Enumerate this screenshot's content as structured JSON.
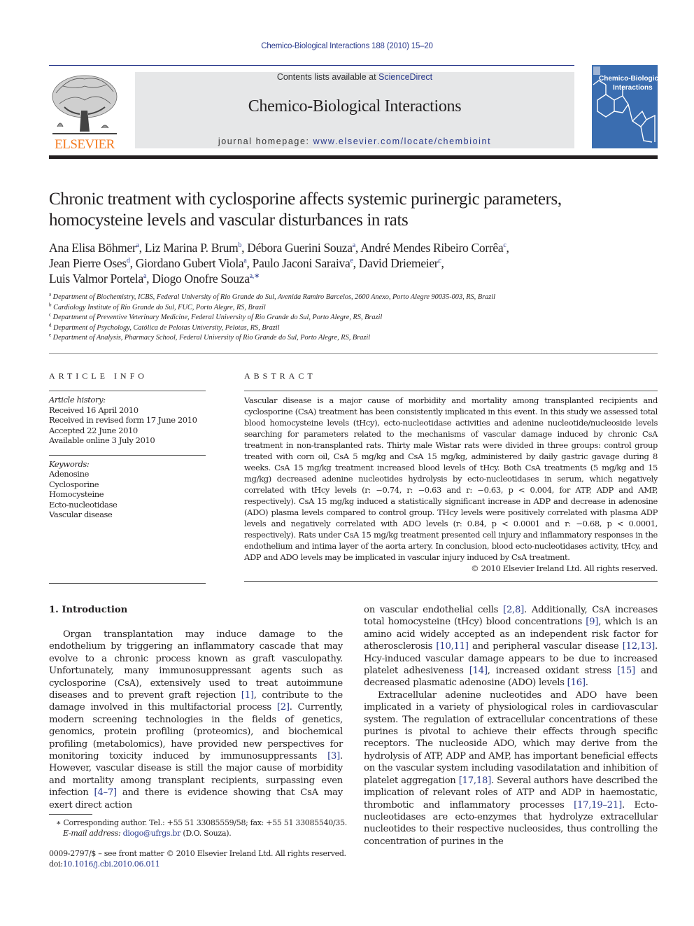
{
  "header": {
    "running_head": "Chemico-Biological Interactions 188 (2010) 15–20",
    "publisher": "ELSEVIER",
    "contents_prefix": "Contents lists available at ",
    "contents_link": "ScienceDirect",
    "journal_name": "Chemico-Biological Interactions",
    "homepage_prefix": "journal homepage: ",
    "homepage_link": "www.elsevier.com/locate/chembioint",
    "cover": {
      "title_line1": "Chemico-Biological",
      "title_line2": "Interactions",
      "color": "#3a6db0"
    }
  },
  "article": {
    "title_line1": "Chronic treatment with cyclosporine affects systemic purinergic parameters,",
    "title_line2": "homocysteine levels and vascular disturbances in rats",
    "authors": [
      {
        "name": "Ana Elisa Böhmer",
        "aff": "a"
      },
      {
        "name": "Liz Marina P. Brum",
        "aff": "b"
      },
      {
        "name": "Débora Guerini Souza",
        "aff": "a"
      },
      {
        "name": "André Mendes Ribeiro Corrêa",
        "aff": "c"
      },
      {
        "name": "Jean Pierre Oses",
        "aff": "d"
      },
      {
        "name": "Giordano Gubert Viola",
        "aff": "a"
      },
      {
        "name": "Paulo Jaconi Saraiva",
        "aff": "e"
      },
      {
        "name": "David Driemeier",
        "aff": "c"
      },
      {
        "name": "Luis Valmor Portela",
        "aff": "a"
      },
      {
        "name": "Diogo Onofre Souza",
        "aff": "a,∗"
      }
    ],
    "affiliations": [
      {
        "mark": "a",
        "text": "Department of Biochemistry, ICBS, Federal University of Rio Grande do Sul, Avenida Ramiro Barcelos, 2600 Anexo, Porto Alegre 90035-003, RS, Brazil"
      },
      {
        "mark": "b",
        "text": "Cardiology Institute of Rio Grande do Sul, FUC, Porto Alegre, RS, Brazil"
      },
      {
        "mark": "c",
        "text": "Department of Preventive Veterinary Medicine, Federal University of Rio Grande do Sul, Porto Alegre, RS, Brazil"
      },
      {
        "mark": "d",
        "text": "Department of Psychology, Católica de Pelotas University, Pelotas, RS, Brazil"
      },
      {
        "mark": "e",
        "text": "Department of Analysis, Pharmacy School, Federal University of Rio Grande do Sul, Porto Alegre, RS, Brazil"
      }
    ]
  },
  "article_info": {
    "label": "ARTICLE INFO",
    "history_head": "Article history:",
    "history": [
      "Received 16 April 2010",
      "Received in revised form 17 June 2010",
      "Accepted 22 June 2010",
      "Available online 3 July 2010"
    ],
    "keywords_head": "Keywords:",
    "keywords": [
      "Adenosine",
      "Cyclosporine",
      "Homocysteine",
      "Ecto-nucleotidase",
      "Vascular disease"
    ]
  },
  "abstract": {
    "label": "ABSTRACT",
    "text": "Vascular disease is a major cause of morbidity and mortality among transplanted recipients and cyclosporine (CsA) treatment has been consistently implicated in this event. In this study we assessed total blood homocysteine levels (tHcy), ecto-nucleotidase activities and adenine nucleotide/nucleoside levels searching for parameters related to the mechanisms of vascular damage induced by chronic CsA treatment in non-transplanted rats. Thirty male Wistar rats were divided in three groups: control group treated with corn oil, CsA 5 mg/kg and CsA 15 mg/kg, administered by daily gastric gavage during 8 weeks. CsA 15 mg/kg treatment increased blood levels of tHcy. Both CsA treatments (5 mg/kg and 15 mg/kg) decreased adenine nucleotides hydrolysis by ecto-nucleotidases in serum, which negatively correlated with tHcy levels (r: −0.74, r: −0.63 and r: −0.63, p < 0.004, for ATP, ADP and AMP, respectively). CsA 15 mg/kg induced a statistically significant increase in ADP and decrease in adenosine (ADO) plasma levels compared to control group. THcy levels were positively correlated with plasma ADP levels and negatively correlated with ADO levels (r: 0.84, p < 0.0001 and r: −0.68, p < 0.0001, respectively). Rats under CsA 15 mg/kg treatment presented cell injury and inflammatory responses in the endothelium and intima layer of the aorta artery. In conclusion, blood ecto-nucleotidases activity, tHcy, and ADP and ADO levels may be implicated in vascular injury induced by CsA treatment.",
    "copyright": "© 2010 Elsevier Ireland Ltd. All rights reserved."
  },
  "introduction": {
    "heading": "1.  Introduction",
    "left_segments": [
      {
        "t": "Organ transplantation may induce damage to the endothelium by triggering an inflammatory cascade that may evolve to a chronic process known as graft vasculopathy. Unfortunately, many immunosuppressant agents such as cyclosporine (CsA), extensively used to treat autoimmune diseases and to prevent graft rejection "
      },
      {
        "t": "[1]",
        "link": true
      },
      {
        "t": ", contribute to the damage involved in this multifactorial process "
      },
      {
        "t": "[2]",
        "link": true
      },
      {
        "t": ". Currently, modern screening technologies in the fields of genetics, genomics, protein profiling (proteomics), and biochemical profiling (metabolomics), have provided new perspectives for monitoring toxicity induced by immunosuppressants "
      },
      {
        "t": "[3]",
        "link": true
      },
      {
        "t": ". However, vascular disease is still the major cause of morbidity and mortality among transplant recipients, surpassing even infection "
      },
      {
        "t": "[4–7]",
        "link": true
      },
      {
        "t": " and there is evidence showing that CsA may exert direct action"
      }
    ],
    "right_p1": [
      {
        "t": "on vascular endothelial cells "
      },
      {
        "t": "[2,8]",
        "link": true
      },
      {
        "t": ". Additionally, CsA increases total homocysteine (tHcy) blood concentrations "
      },
      {
        "t": "[9]",
        "link": true
      },
      {
        "t": ", which is an amino acid widely accepted as an independent risk factor for atherosclerosis "
      },
      {
        "t": "[10,11]",
        "link": true
      },
      {
        "t": " and peripheral vascular disease "
      },
      {
        "t": "[12,13]",
        "link": true
      },
      {
        "t": ". Hcy-induced vascular damage appears to be due to increased platelet adhesiveness "
      },
      {
        "t": "[14]",
        "link": true
      },
      {
        "t": ", increased oxidant stress "
      },
      {
        "t": "[15]",
        "link": true
      },
      {
        "t": " and decreased plasmatic adenosine (ADO) levels "
      },
      {
        "t": "[16]",
        "link": true
      },
      {
        "t": "."
      }
    ],
    "right_p2": [
      {
        "t": "Extracellular adenine nucleotides and ADO have been implicated in a variety of physiological roles in cardiovascular system. The regulation of extracellular concentrations of these purines is pivotal to achieve their effects through specific receptors. The nucleoside ADO, which may derive from the hydrolysis of ATP, ADP and AMP, has important beneficial effects on the vascular system including vasodilatation and inhibition of platelet aggregation "
      },
      {
        "t": "[17,18]",
        "link": true
      },
      {
        "t": ". Several authors have described the implication of relevant roles of ATP and ADP in haemostatic, thrombotic and inflammatory processes "
      },
      {
        "t": "[17,19–21]",
        "link": true
      },
      {
        "t": ". Ecto-nucleotidases are ecto-enzymes that hydrolyze extracellular nucleotides to their respective nucleosides, thus controlling the concentration of purines in the"
      }
    ]
  },
  "footnote": {
    "mark": "∗",
    "text": " Corresponding author. Tel.: +55 51 33085559/58; fax: +55 51 33085540/35.",
    "email_label": "E-mail address: ",
    "email": "diogo@ufrgs.br",
    "email_suffix": " (D.O. Souza)."
  },
  "front_matter": {
    "issn_line": "0009-2797/$ – see front matter © 2010 Elsevier Ireland Ltd. All rights reserved.",
    "doi_prefix": "doi:",
    "doi": "10.1016/j.cbi.2010.06.011"
  },
  "colors": {
    "link": "#2a3a8c",
    "masthead_bg": "#e6e7e8",
    "elsevier_orange": "#f47b20"
  }
}
